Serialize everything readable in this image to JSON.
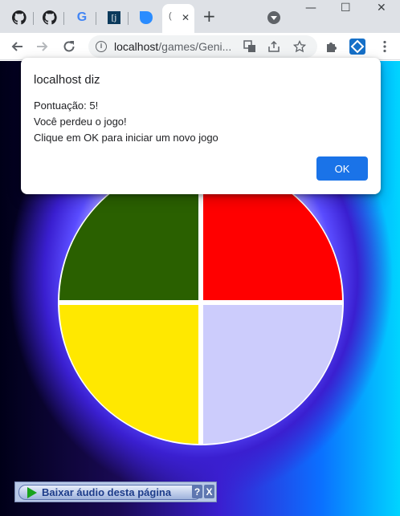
{
  "browser": {
    "tabs": [
      {
        "name": "tab-github-1",
        "icon": "github-icon"
      },
      {
        "name": "tab-github-2",
        "icon": "github-icon"
      },
      {
        "name": "tab-google",
        "icon": "google-icon",
        "text": "G"
      },
      {
        "name": "tab-site",
        "icon": "site-icon",
        "text": "[j"
      },
      {
        "name": "tab-droplet",
        "icon": "droplet-icon"
      },
      {
        "name": "tab-active",
        "text": "(",
        "close": "✕"
      }
    ],
    "new_tab": "+",
    "window_controls": {
      "minimize": "—",
      "maximize": "☐",
      "close": "✕"
    },
    "address": {
      "host": "localhost",
      "path": "/games/Geni..."
    }
  },
  "dialog": {
    "title": "localhost diz",
    "lines": [
      "Pontuação: 5!",
      "Você perdeu o jogo!",
      "Clique em OK para iniciar um novo jogo"
    ],
    "ok_label": "OK"
  },
  "game": {
    "colors": {
      "top_left": "#2a6000",
      "top_right": "#ff0000",
      "bottom_left": "#ffe800",
      "bottom_right": "#ccccfc",
      "divider": "#ffffff"
    }
  },
  "audio_widget": {
    "label": "Baixar áudio desta página",
    "help": "?",
    "close": "X"
  }
}
